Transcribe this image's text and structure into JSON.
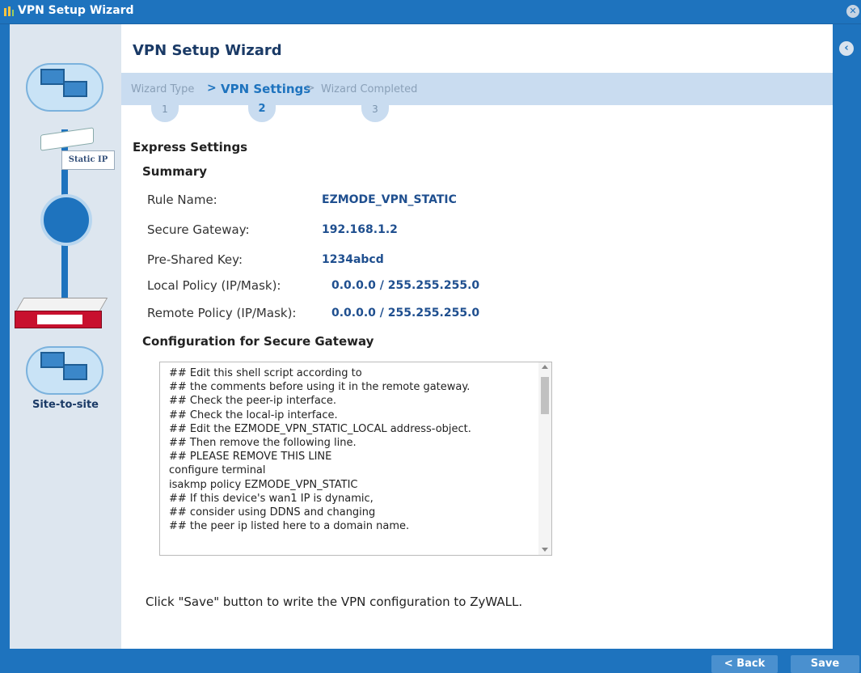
{
  "window": {
    "title": "VPN Setup Wizard"
  },
  "wizard": {
    "title": "VPN Setup Wizard",
    "steps": [
      {
        "label": "Wizard Type",
        "number": "1"
      },
      {
        "label": "VPN Settings",
        "number": "2"
      },
      {
        "label": "Wizard Completed",
        "number": "3"
      }
    ],
    "separator": ">"
  },
  "sidebar": {
    "static_ip_label": "Static IP",
    "site_to_site_label": "Site-to-site"
  },
  "express": {
    "heading": "Express Settings",
    "summary_heading": "Summary",
    "fields": [
      {
        "label": "Rule Name:",
        "value": "EZMODE_VPN_STATIC"
      },
      {
        "label": "Secure Gateway:",
        "value": "192.168.1.2"
      },
      {
        "label": "Pre-Shared Key:",
        "value": "1234abcd"
      },
      {
        "label": "Local Policy (IP/Mask):",
        "value": "0.0.0.0 / 255.255.255.0"
      },
      {
        "label": "Remote Policy (IP/Mask):",
        "value": "0.0.0.0 / 255.255.255.0"
      }
    ]
  },
  "config": {
    "heading": "Configuration for Secure Gateway",
    "script_lines": [
      "## Edit this shell script according to",
      "## the comments before using it in the remote gateway.",
      "## Check the peer-ip interface.",
      "## Check the local-ip interface.",
      "## Edit the EZMODE_VPN_STATIC_LOCAL address-object.",
      "## Then remove the following line.",
      "## PLEASE REMOVE THIS LINE",
      "configure terminal",
      "isakmp policy EZMODE_VPN_STATIC",
      "## If this device's wan1 IP is dynamic,",
      "## consider using DDNS and changing",
      "## the peer ip listed here to a domain name."
    ]
  },
  "footer": {
    "note": "Click \"Save\" button to write the VPN configuration to ZyWALL.",
    "back_label": "< Back",
    "save_label": "Save"
  }
}
